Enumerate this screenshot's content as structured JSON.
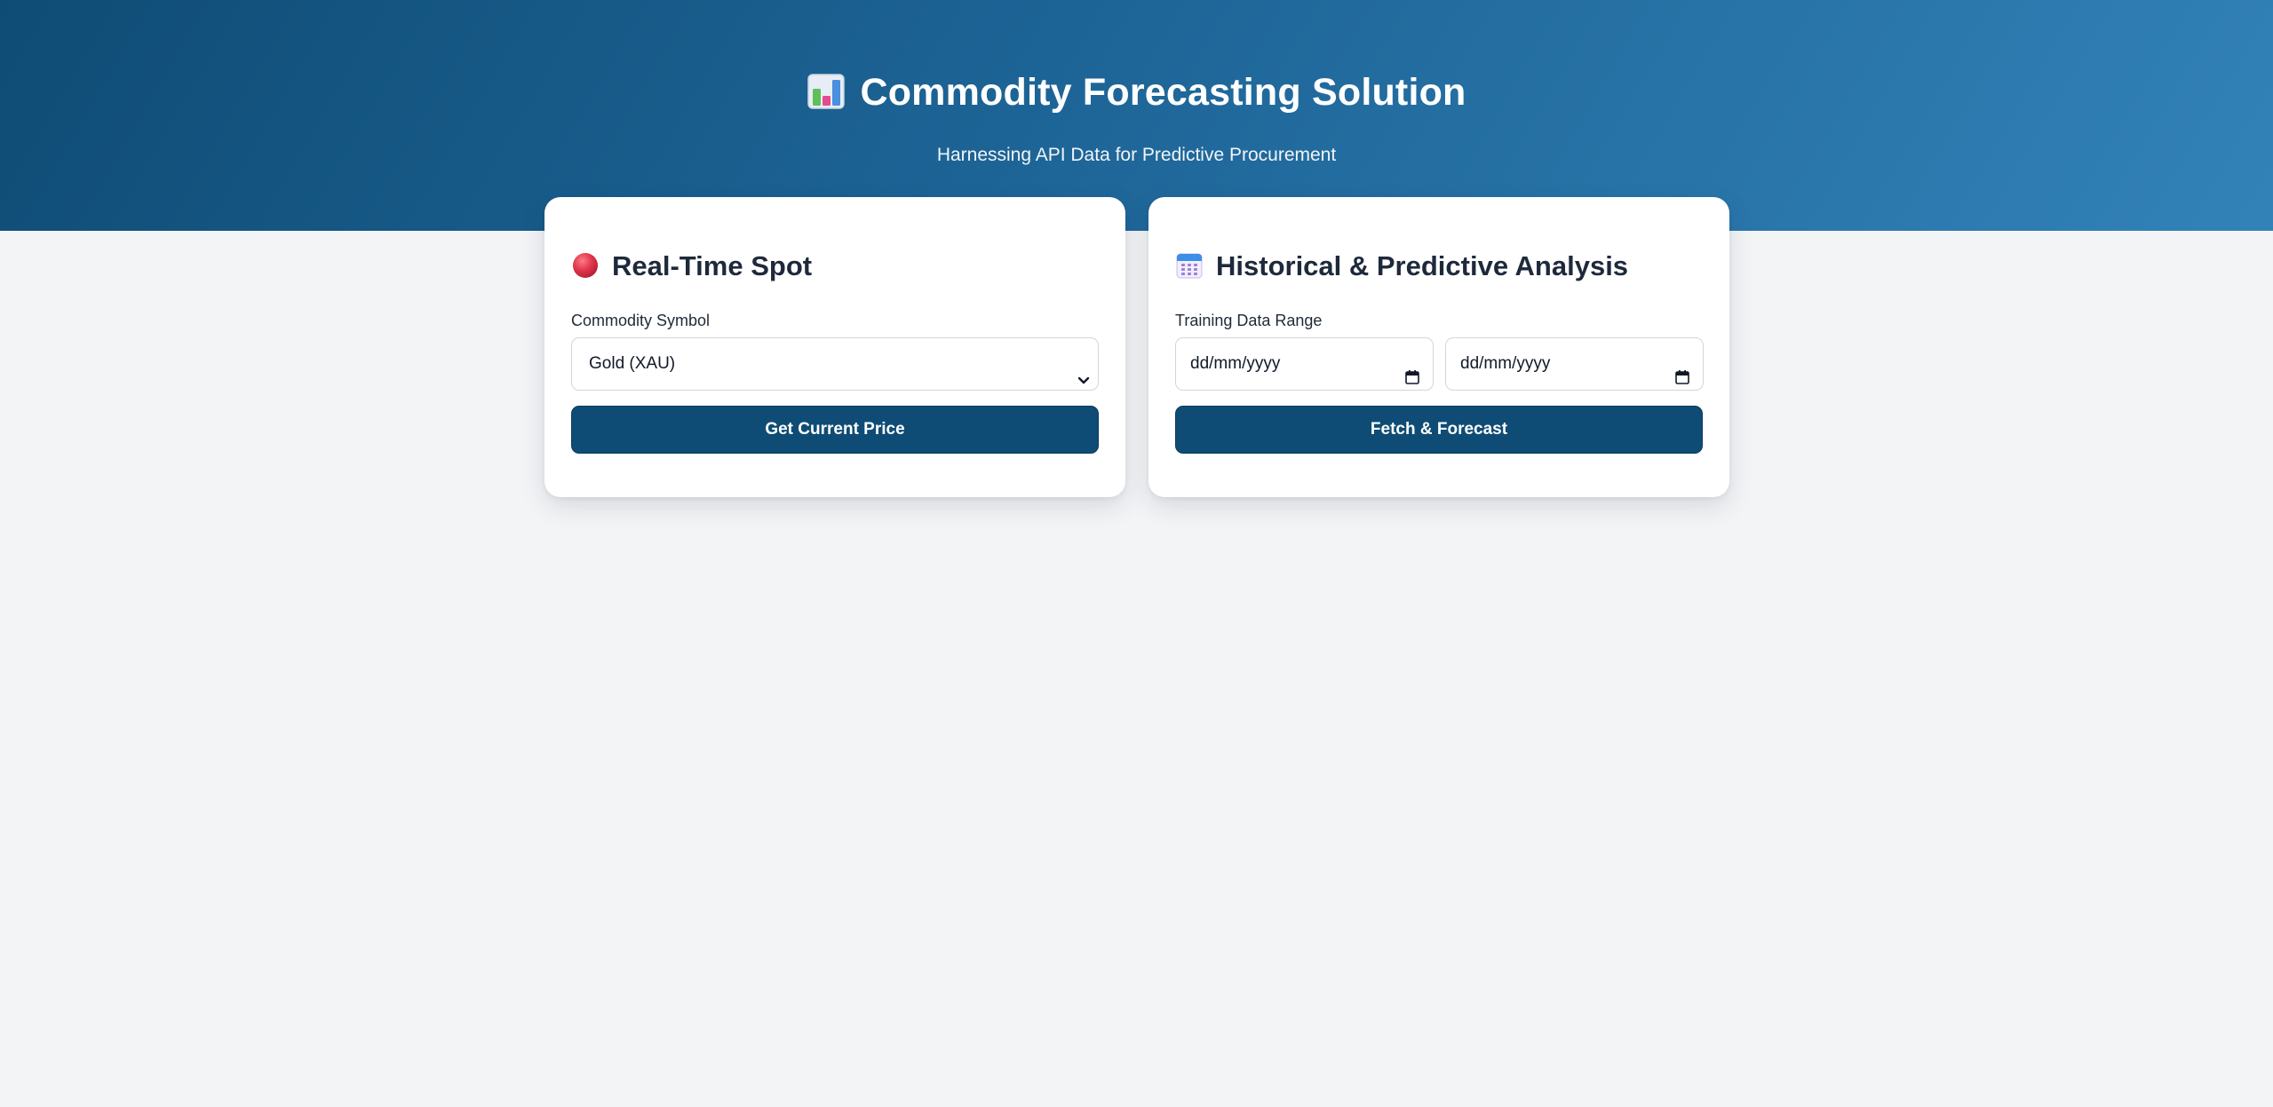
{
  "header": {
    "title": "Commodity Forecasting Solution",
    "title_icon": "bar-chart-icon",
    "subtitle": "Harnessing API Data for Predictive Procurement"
  },
  "spot_card": {
    "icon": "red-circle-icon",
    "title": "Real-Time Spot",
    "field_label": "Commodity Symbol",
    "selected_value": "Gold (XAU)",
    "button_label": "Get Current Price"
  },
  "analysis_card": {
    "icon": "calendar-icon",
    "title": "Historical & Predictive Analysis",
    "field_label": "Training Data Range",
    "start_date_value": "dd/mm/yyyy",
    "end_date_value": "dd/mm/yyyy",
    "button_label": "Fetch & Forecast"
  },
  "colors": {
    "header_gradient_start": "#0f4c75",
    "header_gradient_end": "#3282b8",
    "button": "#0f4c75",
    "page_background": "#f3f4f6"
  }
}
